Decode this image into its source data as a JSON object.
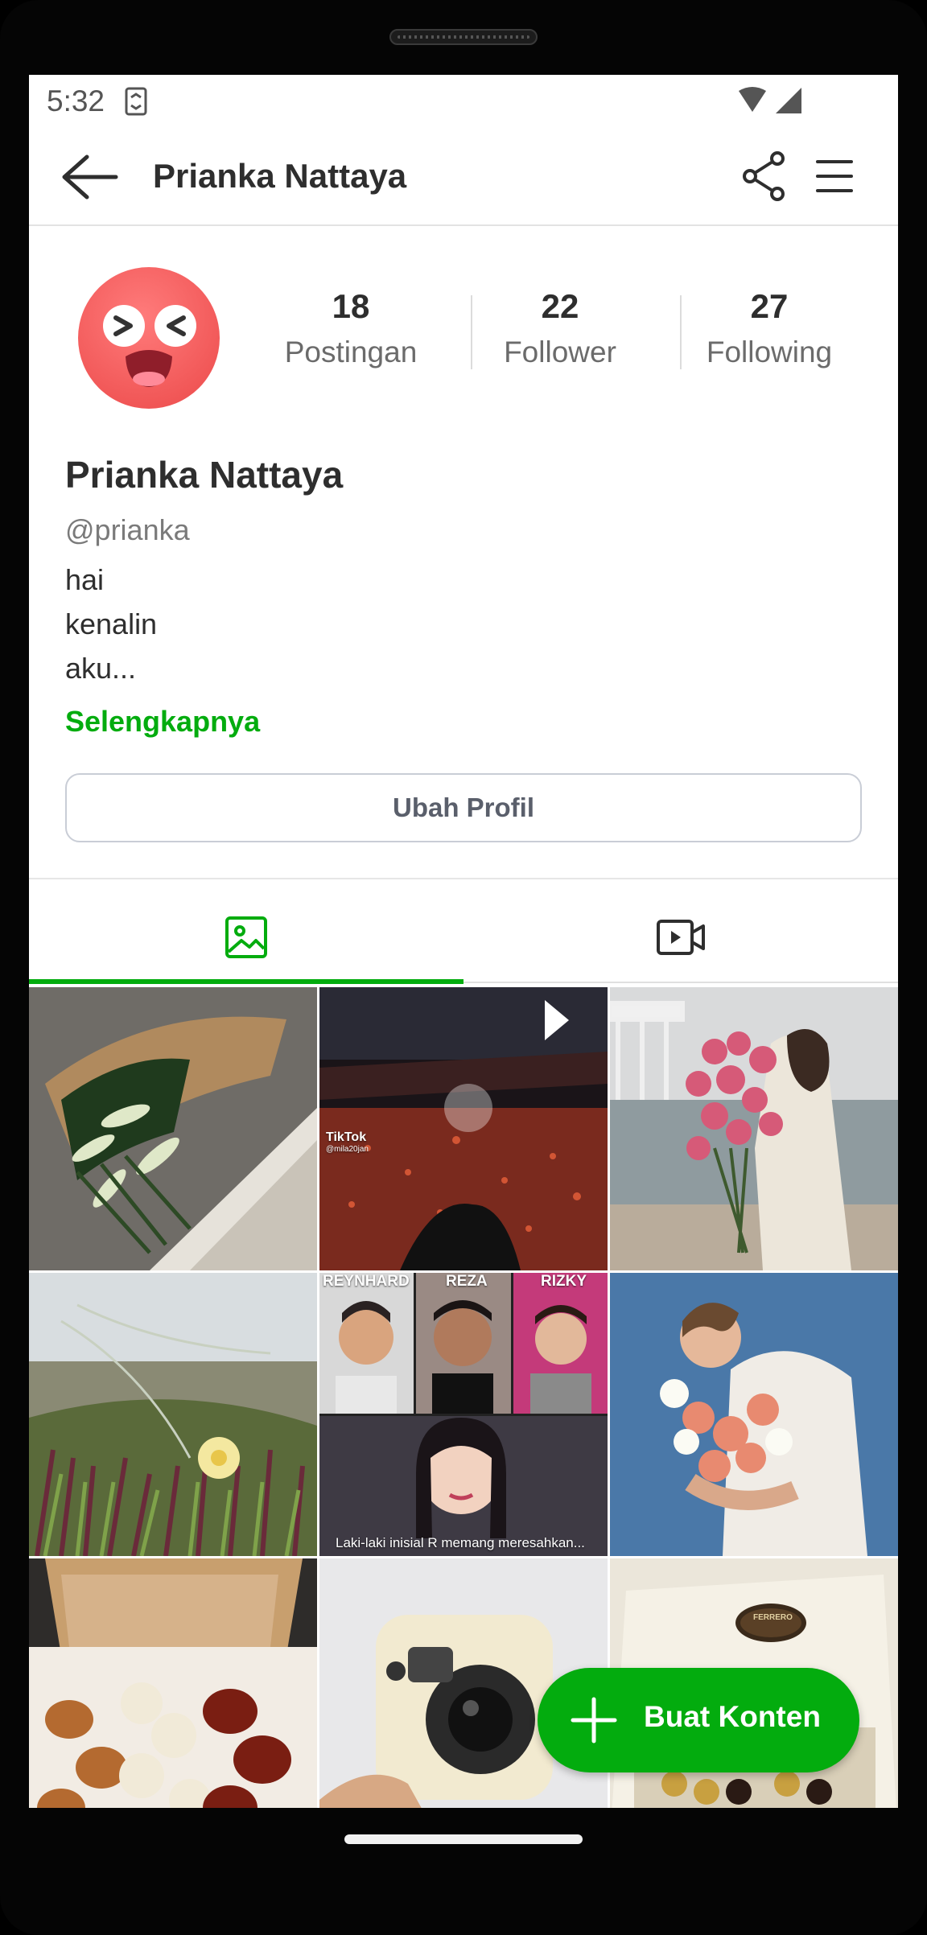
{
  "status_bar": {
    "time": "5:32"
  },
  "header": {
    "title": "Prianka Nattaya"
  },
  "profile": {
    "name": "Prianka Nattaya",
    "handle": "@prianka",
    "bio": [
      "hai",
      "kenalin",
      "aku..."
    ],
    "more_link": "Selengkapnya",
    "edit_button": "Ubah Profil"
  },
  "stats": [
    {
      "value": "18",
      "label": "Postingan"
    },
    {
      "value": "22",
      "label": "Follower"
    },
    {
      "value": "27",
      "label": "Following"
    }
  ],
  "tabs": [
    {
      "icon": "image-icon",
      "active": true
    },
    {
      "icon": "video-icon",
      "active": false
    }
  ],
  "grid": {
    "tile2": {
      "watermark": "TikTok",
      "watermark_user": "@mila20jan"
    },
    "tile5": {
      "names": [
        "REYNHARD",
        "REZA",
        "RIZKY"
      ],
      "caption": "Laki-laki inisial R memang meresahkan..."
    },
    "tile9": {
      "logo_text": "FERRERO"
    }
  },
  "fab": {
    "label": "Buat Konten",
    "icon": "plus-icon"
  },
  "colors": {
    "accent": "#03ac0e",
    "text": "#2e2e2e",
    "muted": "#6b6b6b"
  }
}
